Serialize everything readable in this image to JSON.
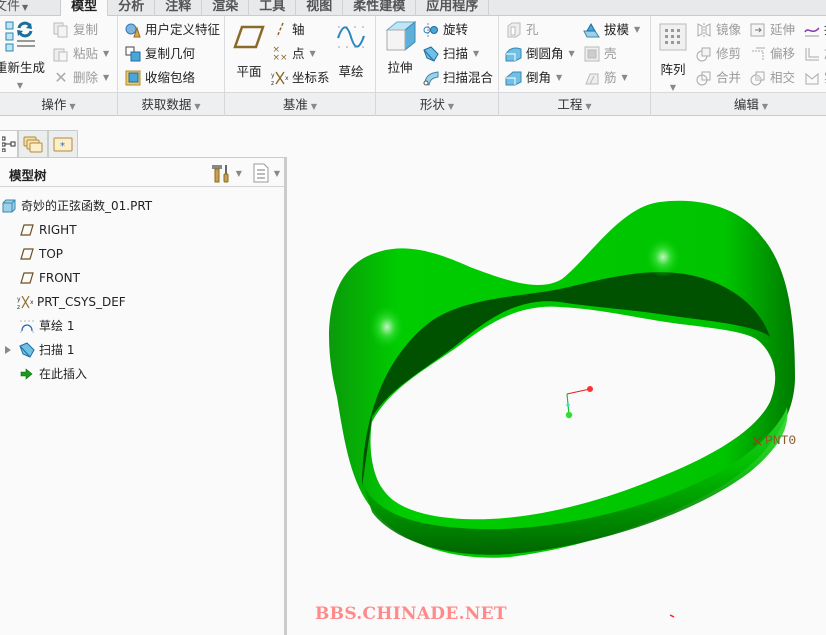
{
  "menu_tabs": [
    {
      "label": "文件",
      "icon": "caret-down-icon"
    },
    {
      "label": "模型",
      "active": true
    },
    {
      "label": "分析"
    },
    {
      "label": "注释"
    },
    {
      "label": "渲染"
    },
    {
      "label": "工具"
    },
    {
      "label": "视图"
    },
    {
      "label": "柔性建模"
    },
    {
      "label": "应用程序"
    }
  ],
  "ribbon": {
    "operations": {
      "group_label": "操作",
      "regenerate": "重新生成",
      "copy": "复制",
      "paste": "粘贴",
      "delete": "删除"
    },
    "get_data": {
      "group_label": "获取数据",
      "user_defined_feature": "用户定义特征",
      "copy_geometry": "复制几何",
      "shrinkwrap": "收缩包络"
    },
    "datum": {
      "group_label": "基准",
      "plane": "平面",
      "axis": "轴",
      "point": "点",
      "coordinate_system": "坐标系",
      "sketch": "草绘"
    },
    "shapes": {
      "group_label": "形状",
      "extrude": "拉伸",
      "revolve": "旋转",
      "sweep": "扫描",
      "swept_blend": "扫描混合"
    },
    "engineering": {
      "group_label": "工程",
      "hole": "孔",
      "round": "倒圆角",
      "chamfer": "倒角",
      "draft": "拔模",
      "shell": "壳",
      "rib": "筋"
    },
    "editing": {
      "group_label": "编辑",
      "pattern": "阵列",
      "mirror": "镜像",
      "trim": "修剪",
      "merge": "合并",
      "extend": "延伸",
      "offset": "偏移",
      "intersect": "相交",
      "project": "投",
      "thicken": "加",
      "solidify": "实"
    }
  },
  "navigator": {
    "tabs": [
      "model-tree-tab",
      "folder-browser-tab",
      "favorites-tab"
    ],
    "panel_title": "模型树"
  },
  "model_tree": [
    {
      "label": "奇妙的正弦函数_01.PRT",
      "icon": "part-icon"
    },
    {
      "label": "RIGHT",
      "icon": "datum-plane-icon"
    },
    {
      "label": "TOP",
      "icon": "datum-plane-icon"
    },
    {
      "label": "FRONT",
      "icon": "datum-plane-icon"
    },
    {
      "label": "PRT_CSYS_DEF",
      "icon": "coordinate-system-icon"
    },
    {
      "label": "草绘 1",
      "icon": "sketch-icon"
    },
    {
      "label": "扫描 1",
      "icon": "sweep-icon",
      "expandable": true
    },
    {
      "label": "在此插入",
      "icon": "insert-here-arrow-icon"
    }
  ],
  "viewport": {
    "datum_point_label": "PNT0",
    "watermark": "BBS.CHINADE.NET",
    "model_color": "#00cc00"
  }
}
